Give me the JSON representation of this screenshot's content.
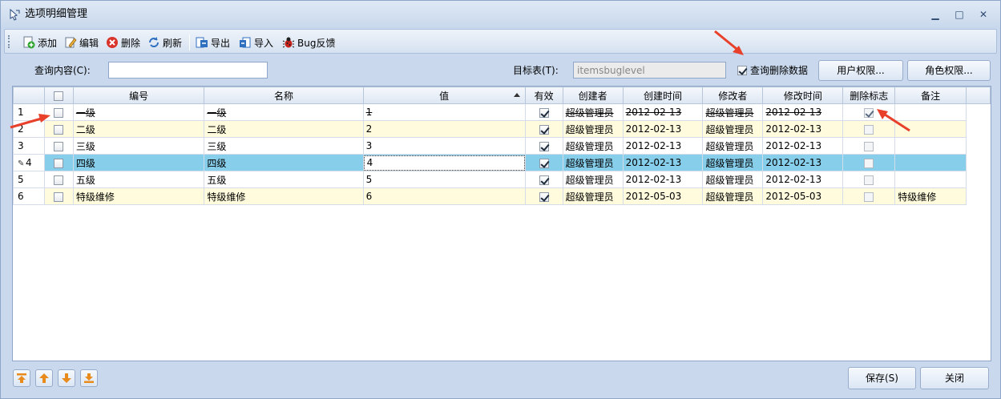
{
  "window": {
    "title": "选项明细管理",
    "minimize": "▁",
    "restore": "□",
    "close": "✕"
  },
  "toolbar": {
    "add": "添加",
    "edit": "编辑",
    "delete": "删除",
    "refresh": "刷新",
    "export": "导出",
    "import": "导入",
    "bug": "Bug反馈"
  },
  "query": {
    "content_label": "查询内容(C):",
    "content_value": "",
    "target_label": "目标表(T):",
    "target_value": "itemsbuglevel",
    "show_deleted_label": "查询删除数据",
    "show_deleted_checked": true,
    "user_perm_button": "用户权限...",
    "role_perm_button": "角色权限..."
  },
  "grid": {
    "columns": [
      "编号",
      "名称",
      "值",
      "有效",
      "创建者",
      "创建时间",
      "修改者",
      "修改时间",
      "删除标志",
      "备注"
    ],
    "rows": [
      {
        "n": "1",
        "code": "一级",
        "name": "一级",
        "value": "1",
        "valid": true,
        "creator": "超级管理员",
        "ctime": "2012-02-13",
        "modifier": "超级管理员",
        "mtime": "2012-02-13",
        "deleted": true,
        "note": ""
      },
      {
        "n": "2",
        "code": "二级",
        "name": "二级",
        "value": "2",
        "valid": true,
        "creator": "超级管理员",
        "ctime": "2012-02-13",
        "modifier": "超级管理员",
        "mtime": "2012-02-13",
        "deleted": false,
        "note": ""
      },
      {
        "n": "3",
        "code": "三级",
        "name": "三级",
        "value": "3",
        "valid": true,
        "creator": "超级管理员",
        "ctime": "2012-02-13",
        "modifier": "超级管理员",
        "mtime": "2012-02-13",
        "deleted": false,
        "note": ""
      },
      {
        "n": "4",
        "code": "四级",
        "name": "四级",
        "value": "4",
        "valid": true,
        "creator": "超级管理员",
        "ctime": "2012-02-13",
        "modifier": "超级管理员",
        "mtime": "2012-02-13",
        "deleted": false,
        "note": ""
      },
      {
        "n": "5",
        "code": "五级",
        "name": "五级",
        "value": "5",
        "valid": true,
        "creator": "超级管理员",
        "ctime": "2012-02-13",
        "modifier": "超级管理员",
        "mtime": "2012-02-13",
        "deleted": false,
        "note": ""
      },
      {
        "n": "6",
        "code": "特级维修",
        "name": "特级维修",
        "value": "6",
        "valid": true,
        "creator": "超级管理员",
        "ctime": "2012-05-03",
        "modifier": "超级管理员",
        "mtime": "2012-05-03",
        "deleted": false,
        "note": "特级维修"
      }
    ]
  },
  "footer": {
    "save": "保存(S)",
    "close": "关闭"
  },
  "colors": {
    "selected_row": "#87ceeb",
    "alt_row": "#fffbdc",
    "arrow": "#e8402a"
  }
}
